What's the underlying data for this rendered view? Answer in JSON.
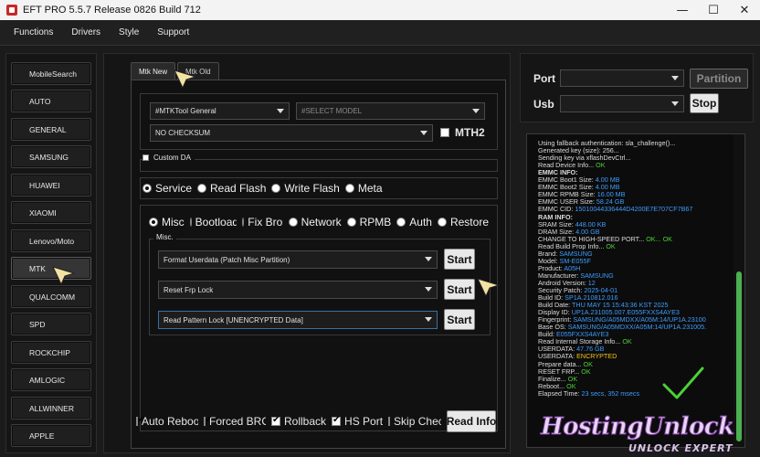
{
  "window": {
    "title": "EFT PRO 5.5.7 Release 0826 Build 712",
    "controls": [
      "—",
      "☐",
      "✕"
    ]
  },
  "menu": [
    "Functions",
    "Drivers",
    "Style",
    "Support"
  ],
  "sidebar": {
    "items": [
      {
        "label": "MobileSearch",
        "active": false
      },
      {
        "label": "AUTO",
        "active": false
      },
      {
        "label": "GENERAL",
        "active": false
      },
      {
        "label": "SAMSUNG",
        "active": false
      },
      {
        "label": "HUAWEI",
        "active": false
      },
      {
        "label": "XIAOMI",
        "active": false
      },
      {
        "label": "Lenovo/Moto",
        "active": false
      },
      {
        "label": "MTK",
        "active": true
      },
      {
        "label": "QUALCOMM",
        "active": false
      },
      {
        "label": "SPD",
        "active": false
      },
      {
        "label": "ROCKCHIP",
        "active": false
      },
      {
        "label": "AMLOGIC",
        "active": false
      },
      {
        "label": "ALLWINNER",
        "active": false
      },
      {
        "label": "APPLE",
        "active": false
      }
    ]
  },
  "tabs": [
    "Mtk New",
    "Mtk Old"
  ],
  "tool_select": {
    "value": "#MTKTool General"
  },
  "model_select": {
    "placeholder": "#SELECT MODEL"
  },
  "checksum_select": {
    "value": "NO CHECKSUM"
  },
  "mth2": {
    "label": "MTH2",
    "checked": false
  },
  "custom_da": {
    "label": "Custom DA",
    "checked": false
  },
  "mode_radios": [
    {
      "label": "Service",
      "checked": true
    },
    {
      "label": "Read Flash",
      "checked": false
    },
    {
      "label": "Write Flash",
      "checked": false
    },
    {
      "label": "Meta",
      "checked": false
    }
  ],
  "func_radios": [
    {
      "label": "Misc",
      "checked": true
    },
    {
      "label": "Bootloader",
      "checked": false
    },
    {
      "label": "Fix Brom",
      "checked": false
    },
    {
      "label": "Network",
      "checked": false
    },
    {
      "label": "RPMB",
      "checked": false
    },
    {
      "label": "Auth",
      "checked": false
    },
    {
      "label": "Restore",
      "checked": false
    }
  ],
  "misc_group_label": "Misc.",
  "operations": [
    {
      "value": "Format Userdata (Patch Misc Partition)",
      "button": "Start"
    },
    {
      "value": "Reset Frp Lock",
      "button": "Start"
    },
    {
      "value": "Read Pattern Lock [UNENCRYPTED Data]",
      "button": "Start"
    }
  ],
  "bottom_options": [
    {
      "label": "Auto Reboot",
      "checked": true
    },
    {
      "label": "Forced BROM",
      "checked": true
    },
    {
      "label": "Rollback",
      "checked": true
    },
    {
      "label": "HS Port",
      "checked": true
    },
    {
      "label": "Skip Check",
      "checked": false
    }
  ],
  "read_info_button": "Read Info",
  "port": {
    "label": "Port",
    "button": "Partition"
  },
  "usb": {
    "label": "Usb",
    "button": "Stop"
  },
  "log": [
    [
      [
        "Using fallback authentication: sla_challenge()...",
        "n"
      ]
    ],
    [
      [
        "Generated key (size): 256...",
        "n"
      ]
    ],
    [
      [
        "Sending key via xflashDevCtrl...",
        "n"
      ]
    ],
    [
      [
        "Read Device Info... ",
        "n"
      ],
      [
        "OK",
        "g"
      ]
    ],
    [
      [
        "EMMC INFO:",
        "b"
      ]
    ],
    [
      [
        "EMMC Boot1 Size: ",
        "n"
      ],
      [
        "4.00 MB",
        "u"
      ]
    ],
    [
      [
        "EMMC Boot2 Size: ",
        "n"
      ],
      [
        "4.00 MB",
        "u"
      ]
    ],
    [
      [
        "EMMC RPMB Size: ",
        "n"
      ],
      [
        "16.00 MB",
        "u"
      ]
    ],
    [
      [
        "EMMC USER Size: ",
        "n"
      ],
      [
        "58.24 GB",
        "u"
      ]
    ],
    [
      [
        "EMMC CID: ",
        "n"
      ],
      [
        "15010044336444D4200E7E707CF7B67",
        "u"
      ]
    ],
    [
      [
        "RAM INFO:",
        "b"
      ]
    ],
    [
      [
        "SRAM Size: ",
        "n"
      ],
      [
        "448.00 KB",
        "u"
      ]
    ],
    [
      [
        "DRAM Size: ",
        "n"
      ],
      [
        "4.00 GB",
        "u"
      ]
    ],
    [
      [
        "CHANGE TO HIGH-SPEED PORT... ",
        "n"
      ],
      [
        "OK... OK",
        "g"
      ]
    ],
    [
      [
        "Read Build Prop Info... ",
        "n"
      ],
      [
        "OK",
        "g"
      ]
    ],
    [
      [
        "   Brand: ",
        "n"
      ],
      [
        "SAMSUNG",
        "u"
      ]
    ],
    [
      [
        "   Model: ",
        "n"
      ],
      [
        "SM-E055F",
        "u"
      ]
    ],
    [
      [
        "   Product: ",
        "n"
      ],
      [
        "A05H",
        "u"
      ]
    ],
    [
      [
        "   Manufacturer: ",
        "n"
      ],
      [
        "SAMSUNG",
        "u"
      ]
    ],
    [
      [
        "   Android Version: ",
        "n"
      ],
      [
        "12",
        "u"
      ]
    ],
    [
      [
        "   Security Patch: ",
        "n"
      ],
      [
        "2025-04-01",
        "u"
      ]
    ],
    [
      [
        "   Build ID: ",
        "n"
      ],
      [
        "SP1A.210812.016",
        "u"
      ]
    ],
    [
      [
        "   Build Date: ",
        "n"
      ],
      [
        "THU MAY 15 15:43:36 KST 2025",
        "u"
      ]
    ],
    [
      [
        "   Display ID: ",
        "n"
      ],
      [
        "UP1A.231005.007.E055FXXS4AYE3",
        "u"
      ]
    ],
    [
      [
        "   Fingerprint: ",
        "n"
      ],
      [
        "SAMSUNG/A05MDXX/A05M:14/UP1A.23100",
        "u"
      ]
    ],
    [
      [
        "   Base OS: ",
        "n"
      ],
      [
        "SAMSUNG/A05MDXX/A05M:14/UP1A.231005.",
        "u"
      ]
    ],
    [
      [
        "   Build: ",
        "n"
      ],
      [
        "E055FXXS4AYE3",
        "u"
      ]
    ],
    [
      [
        "Read Internal Storage Info... ",
        "n"
      ],
      [
        "OK",
        "g"
      ]
    ],
    [
      [
        "USERDATA: ",
        "n"
      ],
      [
        "47.76 GB",
        "u"
      ]
    ],
    [
      [
        "USERDATA: ",
        "n"
      ],
      [
        "ENCRYPTED",
        "y"
      ]
    ],
    [
      [
        "Prepare data... ",
        "n"
      ],
      [
        "OK",
        "g"
      ]
    ],
    [
      [
        "RESET FRP... ",
        "n"
      ],
      [
        "OK",
        "g"
      ]
    ],
    [
      [
        "Finalize... ",
        "n"
      ],
      [
        "OK",
        "g"
      ]
    ],
    [
      [
        "Reboot... ",
        "n"
      ],
      [
        "OK",
        "g"
      ]
    ],
    [
      [
        "Elapsed Time: ",
        "n"
      ],
      [
        "23 secs, 352 msecs",
        "u"
      ]
    ]
  ],
  "watermark": {
    "line1": "HostingUnlock",
    "line2": "UNLOCK EXPERT"
  },
  "colors": {
    "ok_green": "#4cd137",
    "value_blue": "#3d9cff",
    "encrypted_yellow": "#f5c518",
    "scroll_green": "#4caf50"
  }
}
